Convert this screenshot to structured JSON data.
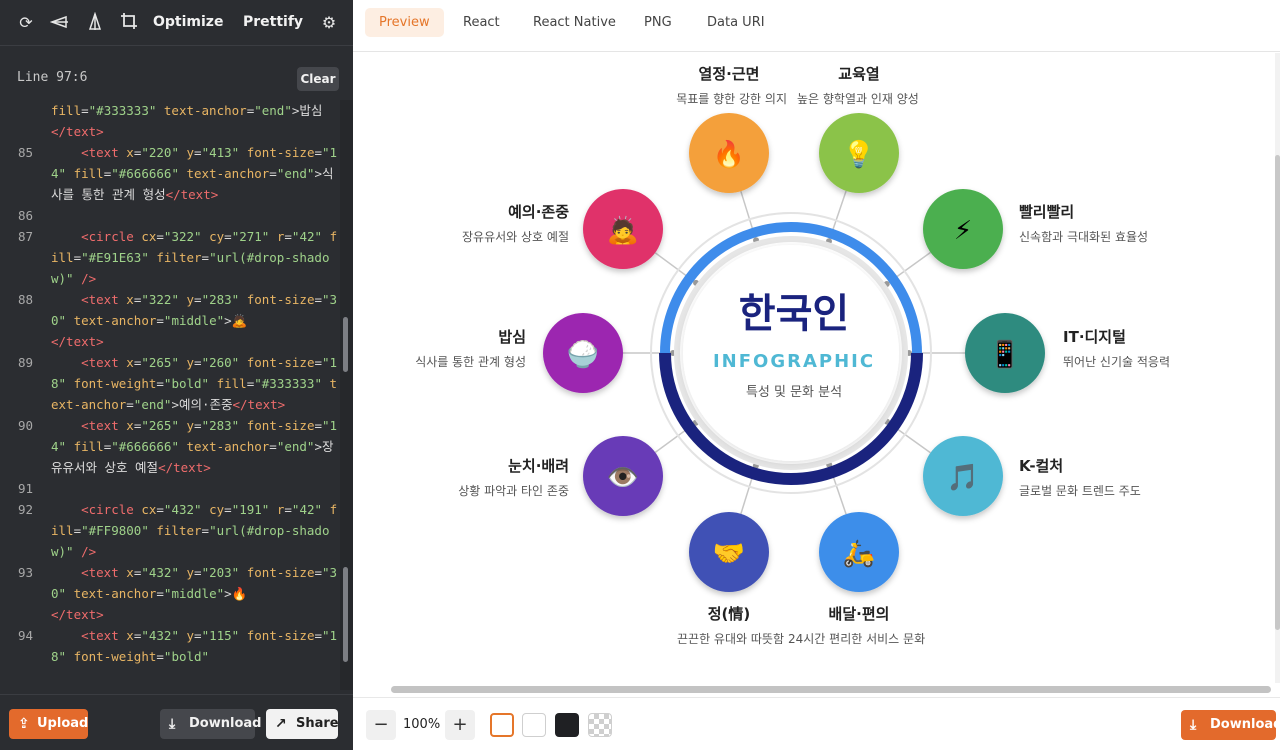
{
  "toolbar": {
    "optimize_label": "Optimize",
    "prettify_label": "Prettify"
  },
  "status": {
    "line_info": "Line 97:6",
    "clear_label": "Clear"
  },
  "code_lines": [
    {
      "num": "",
      "html": "<span class=\"attr\">fill</span>=<span class=\"val\">\"#333333\"</span> <span class=\"attr\">text-anchor</span>=<span class=\"val\">\"end\"</span>&gt;<span class=\"txt\">밥심</span>"
    },
    {
      "num": "",
      "html": "<span class=\"tag\">&lt;/text&gt;</span>"
    },
    {
      "num": "85",
      "html": "    <span class=\"tag\">&lt;text</span> <span class=\"attr\">x</span>=<span class=\"val\">\"220\"</span> <span class=\"attr\">y</span>=<span class=\"val\">\"413\"</span> <span class=\"attr\">font-size</span>=<span class=\"val\">\"14\"</span> <span class=\"attr\">fill</span>=<span class=\"val\">\"#666666\"</span> <span class=\"attr\">text-anchor</span>=<span class=\"val\">\"end\"</span>&gt;<span class=\"txt\">식사를 통한 관계 형성</span><span class=\"tag\">&lt;/text&gt;</span>"
    },
    {
      "num": "86",
      "html": ""
    },
    {
      "num": "87",
      "html": "    <span class=\"tag\">&lt;circle</span> <span class=\"attr\">cx</span>=<span class=\"val\">\"322\"</span> <span class=\"attr\">cy</span>=<span class=\"val\">\"271\"</span> <span class=\"attr\">r</span>=<span class=\"val\">\"42\"</span> <span class=\"attr\">fill</span>=<span class=\"val\">\"#E91E63\"</span> <span class=\"attr\">filter</span>=<span class=\"val\">\"url(#drop-shadow)\"</span> <span class=\"tag\">/&gt;</span>"
    },
    {
      "num": "88",
      "html": "    <span class=\"tag\">&lt;text</span> <span class=\"attr\">x</span>=<span class=\"val\">\"322\"</span> <span class=\"attr\">y</span>=<span class=\"val\">\"283\"</span> <span class=\"attr\">font-size</span>=<span class=\"val\">\"30\"</span> <span class=\"attr\">text-anchor</span>=<span class=\"val\">\"middle\"</span>&gt;<span class=\"txt\">🙇</span>"
    },
    {
      "num": "",
      "html": "<span class=\"tag\">&lt;/text&gt;</span>"
    },
    {
      "num": "89",
      "html": "    <span class=\"tag\">&lt;text</span> <span class=\"attr\">x</span>=<span class=\"val\">\"265\"</span> <span class=\"attr\">y</span>=<span class=\"val\">\"260\"</span> <span class=\"attr\">font-size</span>=<span class=\"val\">\"18\"</span> <span class=\"attr\">font-weight</span>=<span class=\"val\">\"bold\"</span> <span class=\"attr\">fill</span>=<span class=\"val\">\"#333333\"</span> <span class=\"attr\">text-anchor</span>=<span class=\"val\">\"end\"</span>&gt;<span class=\"txt\">예의·존중</span><span class=\"tag\">&lt;/text&gt;</span>"
    },
    {
      "num": "90",
      "html": "    <span class=\"tag\">&lt;text</span> <span class=\"attr\">x</span>=<span class=\"val\">\"265\"</span> <span class=\"attr\">y</span>=<span class=\"val\">\"283\"</span> <span class=\"attr\">font-size</span>=<span class=\"val\">\"14\"</span> <span class=\"attr\">fill</span>=<span class=\"val\">\"#666666\"</span> <span class=\"attr\">text-anchor</span>=<span class=\"val\">\"end\"</span>&gt;<span class=\"txt\">장유유서와 상호 예절</span><span class=\"tag\">&lt;/text&gt;</span>"
    },
    {
      "num": "91",
      "html": ""
    },
    {
      "num": "92",
      "html": "    <span class=\"tag\">&lt;circle</span> <span class=\"attr\">cx</span>=<span class=\"val\">\"432\"</span> <span class=\"attr\">cy</span>=<span class=\"val\">\"191\"</span> <span class=\"attr\">r</span>=<span class=\"val\">\"42\"</span> <span class=\"attr\">fill</span>=<span class=\"val\">\"#FF9800\"</span> <span class=\"attr\">filter</span>=<span class=\"val\">\"url(#drop-shadow)\"</span> <span class=\"tag\">/&gt;</span>"
    },
    {
      "num": "93",
      "html": "    <span class=\"tag\">&lt;text</span> <span class=\"attr\">x</span>=<span class=\"val\">\"432\"</span> <span class=\"attr\">y</span>=<span class=\"val\">\"203\"</span> <span class=\"attr\">font-size</span>=<span class=\"val\">\"30\"</span> <span class=\"attr\">text-anchor</span>=<span class=\"val\">\"middle\"</span>&gt;<span class=\"txt\">🔥</span>"
    },
    {
      "num": "",
      "html": "<span class=\"tag\">&lt;/text&gt;</span>"
    },
    {
      "num": "94",
      "html": "    <span class=\"tag\">&lt;text</span> <span class=\"attr\">x</span>=<span class=\"val\">\"432\"</span> <span class=\"attr\">y</span>=<span class=\"val\">\"115\"</span> <span class=\"attr\">font-size</span>=<span class=\"val\">\"18\"</span> <span class=\"attr\">font-weight</span>=<span class=\"val\">\"bold\"</span>"
    }
  ],
  "left_bottom": {
    "upload_label": "Upload",
    "download_label": "Download",
    "share_label": "Share"
  },
  "tabs": [
    "Preview",
    "React",
    "React Native",
    "PNG",
    "Data URI"
  ],
  "active_tab": "Preview",
  "infographic": {
    "title": "한국인",
    "subtitle": "INFOGRAPHIC",
    "caption": "특성 및 문화 분석",
    "items": [
      {
        "title": "열정·근면",
        "desc": "목표를 향한 강한 의지",
        "icon": "🔥",
        "icon_name": "fire-icon",
        "color": "#F4A03A"
      },
      {
        "title": "교육열",
        "desc": "높은 향학열과 인재 양성",
        "icon": "💡",
        "icon_name": "lightbulb-icon",
        "color": "#8BC34A"
      },
      {
        "title": "빨리빨리",
        "desc": "신속함과 극대화된 효율성",
        "icon": "⚡",
        "icon_name": "lightning-icon",
        "color": "#4CAF50"
      },
      {
        "title": "IT·디지털",
        "desc": "뛰어난 신기술 적응력",
        "icon": "📱",
        "icon_name": "smartphone-icon",
        "color": "#2E8B7F"
      },
      {
        "title": "K-컬처",
        "desc": "글로벌 문화 트렌드 주도",
        "icon": "🎵",
        "icon_name": "music-note-icon",
        "color": "#4FB8D4"
      },
      {
        "title": "배달·편의",
        "desc": "24시간 편리한 서비스 문화",
        "icon": "🛵",
        "icon_name": "scooter-icon",
        "color": "#3D8EEA"
      },
      {
        "title": "정(情)",
        "desc": "끈끈한 유대와 따뜻함",
        "icon": "🤝",
        "icon_name": "handshake-icon",
        "color": "#3F51B5"
      },
      {
        "title": "눈치·배려",
        "desc": "상황 파악과 타인 존중",
        "icon": "👁️",
        "icon_name": "eye-icon",
        "color": "#673AB7"
      },
      {
        "title": "밥심",
        "desc": "식사를 통한 관계 형성",
        "icon": "🍚",
        "icon_name": "rice-bowl-icon",
        "color": "#9C27B0"
      },
      {
        "title": "예의·존중",
        "desc": "장유유서와 상호 예절",
        "icon": "🙇",
        "icon_name": "bowing-person-icon",
        "color": "#E0306A"
      }
    ]
  },
  "preview_toolbar": {
    "zoom": "100%",
    "download_label": "Download",
    "swatches": [
      "#ffffff",
      "#ffffff",
      "#1f2023",
      "checker"
    ]
  }
}
